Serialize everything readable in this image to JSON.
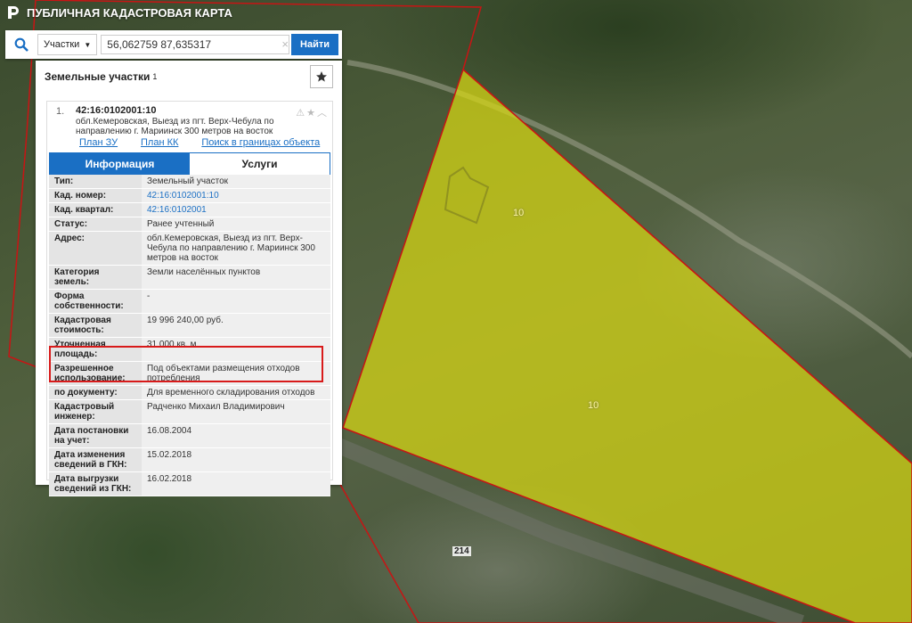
{
  "app": {
    "title": "ПУБЛИЧНАЯ КАДАСТРОВАЯ КАРТА"
  },
  "search": {
    "category": "Участки",
    "query": "56,062759 87,635317",
    "button_label": "Найти",
    "clear_glyph": "×"
  },
  "panel": {
    "title": "Земельные участки",
    "count": "1",
    "favorite_icon": "star-icon"
  },
  "parcel": {
    "index": "1.",
    "cadastral_number": "42:16:0102001:10",
    "address": "обл.Кемеровская, Выезд из пгт. Верх-Чебула по направлению г. Мариинск 300 метров на восток",
    "links": {
      "plan_zu": "План ЗУ →",
      "plan_kk": "План КК →",
      "search_bounds": "Поиск в границах объекта →"
    },
    "tabs": {
      "info": "Информация",
      "services": "Услуги"
    },
    "rows": [
      {
        "k": "Тип:",
        "v": "Земельный участок"
      },
      {
        "k": "Кад. номер:",
        "v": "42:16:0102001:10"
      },
      {
        "k": "Кад. квартал:",
        "v": "42:16:0102001"
      },
      {
        "k": "Статус:",
        "v": "Ранее учтенный"
      },
      {
        "k": "Адрес:",
        "v": "обл.Кемеровская, Выезд из пгт. Верх-Чебула по направлению г. Мариинск 300 метров на восток"
      },
      {
        "k": "Категория земель:",
        "v": "Земли населённых пунктов"
      },
      {
        "k": "Форма собственности:",
        "v": "-"
      },
      {
        "k": "Кадастровая стоимость:",
        "v": "19 996 240,00 руб."
      },
      {
        "k": "Уточненная площадь:",
        "v": "31 000 кв. м"
      },
      {
        "k": "Разрешенное использование:",
        "v": "Под объектами размещения отходов потребления"
      },
      {
        "k": "по документу:",
        "v": "Для временного складирования отходов"
      },
      {
        "k": "Кадастровый инженер:",
        "v": "Радченко Михаил Владимирович"
      },
      {
        "k": "Дата постановки на учет:",
        "v": "16.08.2004"
      },
      {
        "k": "Дата изменения сведений в ГКН:",
        "v": "15.02.2018"
      },
      {
        "k": "Дата выгрузки сведений из ГКН:",
        "v": "16.02.2018"
      }
    ]
  },
  "map": {
    "labels": {
      "parcel_10_a": "10",
      "parcel_10_b": "10",
      "road_214": "214"
    },
    "colors": {
      "parcel_fill": "#d8d814",
      "boundary": "#c81414"
    }
  }
}
